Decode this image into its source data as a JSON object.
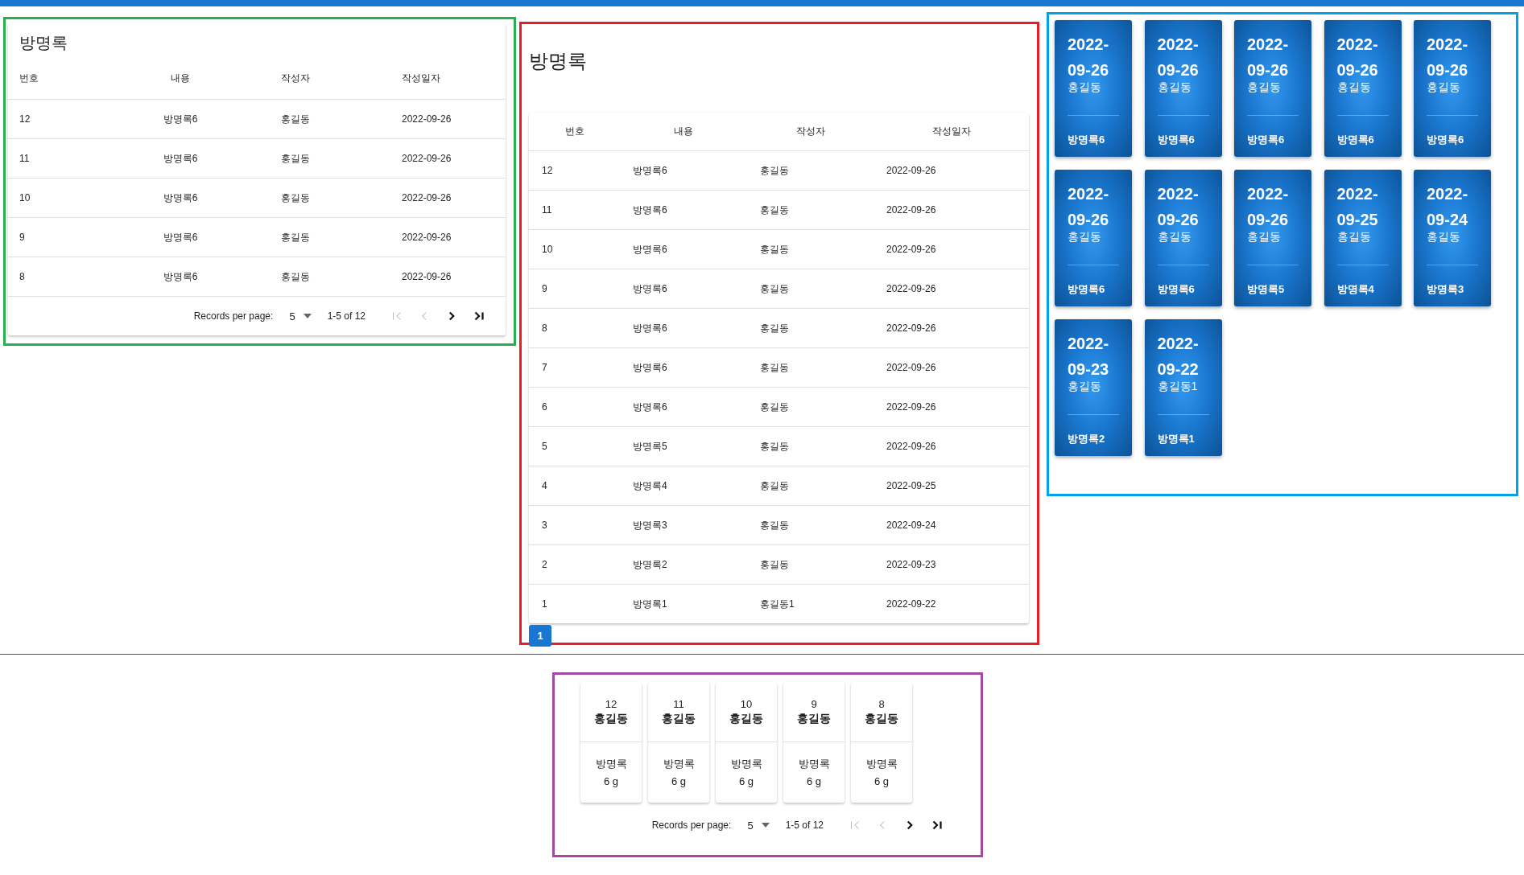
{
  "table_panel": {
    "title": "방명록",
    "columns": [
      "번호",
      "내용",
      "작성자",
      "작성일자"
    ],
    "rows": [
      [
        "12",
        "방명록6",
        "홍길동",
        "2022-09-26"
      ],
      [
        "11",
        "방명록6",
        "홍길동",
        "2022-09-26"
      ],
      [
        "10",
        "방명록6",
        "홍길동",
        "2022-09-26"
      ],
      [
        "9",
        "방명록6",
        "홍길동",
        "2022-09-26"
      ],
      [
        "8",
        "방명록6",
        "홍길동",
        "2022-09-26"
      ]
    ],
    "pagination": {
      "label": "Records per page:",
      "per_page": "5",
      "range": "1-5 of 12",
      "buttons": [
        {
          "kind": "first",
          "disabled": true
        },
        {
          "kind": "prev",
          "disabled": true
        },
        {
          "kind": "next",
          "disabled": false
        },
        {
          "kind": "last",
          "disabled": false
        }
      ]
    }
  },
  "list_panel": {
    "title": "방명록",
    "columns": [
      "번호",
      "내용",
      "작성자",
      "작성일자"
    ],
    "rows": [
      [
        "12",
        "방명록6",
        "홍길동",
        "2022-09-26"
      ],
      [
        "11",
        "방명록6",
        "홍길동",
        "2022-09-26"
      ],
      [
        "10",
        "방명록6",
        "홍길동",
        "2022-09-26"
      ],
      [
        "9",
        "방명록6",
        "홍길동",
        "2022-09-26"
      ],
      [
        "8",
        "방명록6",
        "홍길동",
        "2022-09-26"
      ],
      [
        "7",
        "방명록6",
        "홍길동",
        "2022-09-26"
      ],
      [
        "6",
        "방명록6",
        "홍길동",
        "2022-09-26"
      ],
      [
        "5",
        "방명록5",
        "홍길동",
        "2022-09-26"
      ],
      [
        "4",
        "방명록4",
        "홍길동",
        "2022-09-25"
      ],
      [
        "3",
        "방명록3",
        "홍길동",
        "2022-09-24"
      ],
      [
        "2",
        "방명록2",
        "홍길동",
        "2022-09-23"
      ],
      [
        "1",
        "방명록1",
        "홍길동1",
        "2022-09-22"
      ]
    ],
    "pages": [
      {
        "label": "1",
        "selected": true
      }
    ]
  },
  "card_grid": {
    "cards": [
      {
        "date": "2022-09-26",
        "author": "홍길동",
        "content": "방명록6"
      },
      {
        "date": "2022-09-26",
        "author": "홍길동",
        "content": "방명록6"
      },
      {
        "date": "2022-09-26",
        "author": "홍길동",
        "content": "방명록6"
      },
      {
        "date": "2022-09-26",
        "author": "홍길동",
        "content": "방명록6"
      },
      {
        "date": "2022-09-26",
        "author": "홍길동",
        "content": "방명록6"
      },
      {
        "date": "2022-09-26",
        "author": "홍길동",
        "content": "방명록6"
      },
      {
        "date": "2022-09-26",
        "author": "홍길동",
        "content": "방명록6"
      },
      {
        "date": "2022-09-26",
        "author": "홍길동",
        "content": "방명록5"
      },
      {
        "date": "2022-09-25",
        "author": "홍길동",
        "content": "방명록4"
      },
      {
        "date": "2022-09-24",
        "author": "홍길동",
        "content": "방명록3"
      },
      {
        "date": "2022-09-23",
        "author": "홍길동",
        "content": "방명록2"
      },
      {
        "date": "2022-09-22",
        "author": "홍길동1",
        "content": "방명록1"
      }
    ]
  },
  "mini_cards": {
    "cards": [
      {
        "number": "12",
        "author": "홍길동",
        "content_lines": [
          "방명록",
          "6 g"
        ]
      },
      {
        "number": "11",
        "author": "홍길동",
        "content_lines": [
          "방명록",
          "6 g"
        ]
      },
      {
        "number": "10",
        "author": "홍길동",
        "content_lines": [
          "방명록",
          "6 g"
        ]
      },
      {
        "number": "9",
        "author": "홍길동",
        "content_lines": [
          "방명록",
          "6 g"
        ]
      },
      {
        "number": "8",
        "author": "홍길동",
        "content_lines": [
          "방명록",
          "6 g"
        ]
      }
    ],
    "pagination": {
      "label": "Records per page:",
      "per_page": "5",
      "range": "1-5 of 12",
      "buttons": [
        {
          "kind": "first",
          "disabled": true
        },
        {
          "kind": "prev",
          "disabled": true
        },
        {
          "kind": "next",
          "disabled": false
        },
        {
          "kind": "last",
          "disabled": false
        }
      ]
    }
  }
}
